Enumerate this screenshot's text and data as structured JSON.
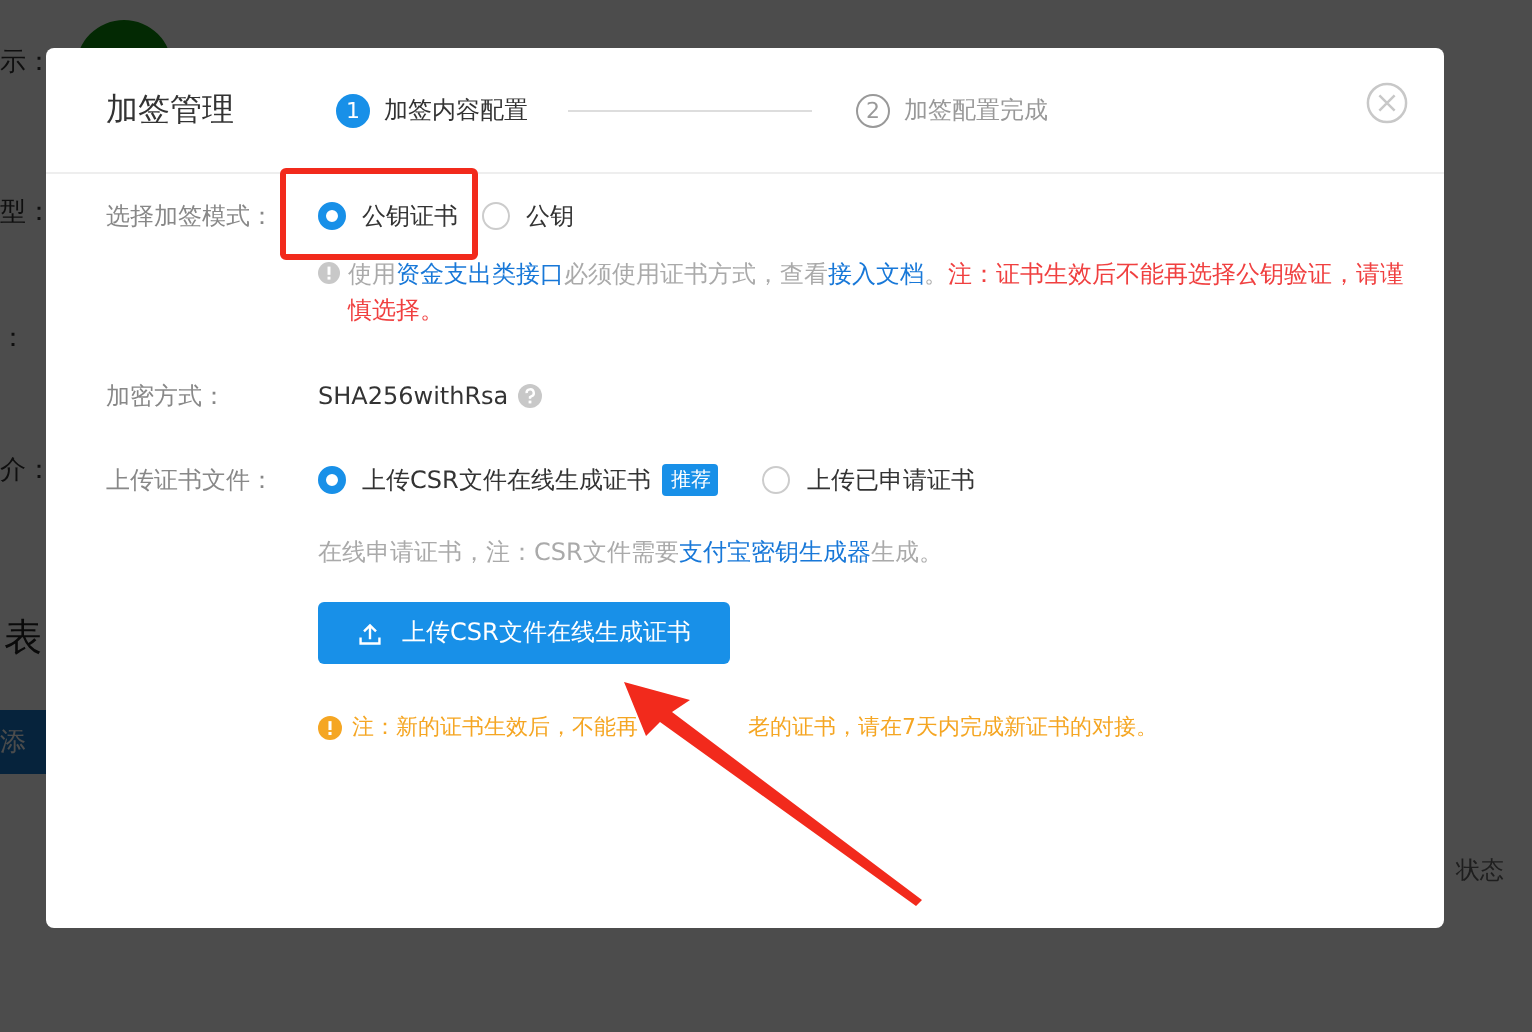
{
  "background": {
    "labels": [
      "示：",
      "型：",
      "：",
      "介："
    ],
    "section_title": "表",
    "add_button": "添",
    "column_header": "状态"
  },
  "dialog": {
    "title": "加签管理",
    "steps": [
      {
        "number": "1",
        "label": "加签内容配置",
        "selected": true
      },
      {
        "number": "2",
        "label": "加签配置完成",
        "selected": false
      }
    ],
    "mode": {
      "label": "选择加签模式：",
      "options": [
        {
          "label": "公钥证书",
          "selected": true
        },
        {
          "label": "公钥",
          "selected": false
        }
      ]
    },
    "mode_note": [
      {
        "kind": "text",
        "text": "使用"
      },
      {
        "kind": "link",
        "text": "资金支出类接口"
      },
      {
        "kind": "text",
        "text": "必须使用证书方式，查看"
      },
      {
        "kind": "link",
        "text": "接入文档"
      },
      {
        "kind": "text",
        "text": "。"
      },
      {
        "kind": "warning",
        "text": "注：证书生效后不能再选择公钥验证，请谨慎选择。"
      }
    ],
    "encryption": {
      "label": "加密方式：",
      "value": "SHA256withRsa"
    },
    "upload": {
      "label": "上传证书文件：",
      "options": [
        {
          "label": "上传CSR文件在线生成证书",
          "badge": "推荐",
          "selected": true
        },
        {
          "label": "上传已申请证书",
          "selected": false
        }
      ]
    },
    "upload_note": [
      {
        "kind": "text",
        "text": "在线申请证书，注：CSR文件需要"
      },
      {
        "kind": "link",
        "text": "支付宝密钥生成器"
      },
      {
        "kind": "text",
        "text": "生成。"
      }
    ],
    "upload_button": "上传CSR文件在线生成证书",
    "warning": [
      "注：新的证书生效后，不能再",
      "老的证书，请在7天内完成新证书的对接。"
    ]
  }
}
